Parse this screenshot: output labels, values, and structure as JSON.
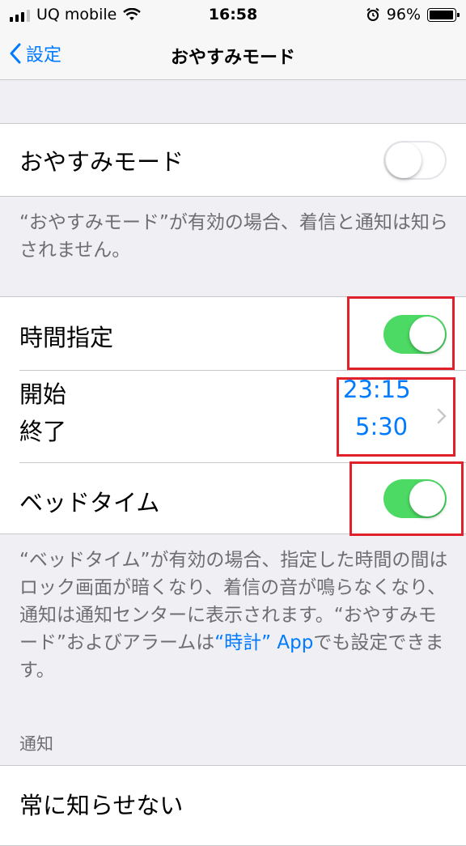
{
  "status": {
    "carrier": "UQ mobile",
    "time": "16:58",
    "battery": "96%"
  },
  "nav": {
    "back_label": "設定",
    "title": "おやすみモード"
  },
  "dnd": {
    "label": "おやすみモード",
    "enabled": false,
    "footer": "“おやすみモード”が有効の場合、着信と通知は知らされません。"
  },
  "schedule": {
    "label": "時間指定",
    "enabled": true,
    "start_label": "開始",
    "end_label": "終了",
    "start_time": "23:15",
    "end_time": "5:30",
    "bedtime_label": "ベッドタイム",
    "bedtime_enabled": true,
    "footer_text": "“ベッドタイム”が有効の場合、指定した時間の間はロック画面が暗くなり、着信の音が鳴らなくなり、通知は通知センターに表示されます。“おやすみモード”およびアラームは",
    "footer_link": "“時計” App",
    "footer_suffix": "でも設定できます。"
  },
  "notifications": {
    "header": "通知",
    "item": "常に知らせない"
  },
  "colors": {
    "accent": "#007aff",
    "toggle_on": "#4cd964",
    "highlight": "#e0202a"
  }
}
